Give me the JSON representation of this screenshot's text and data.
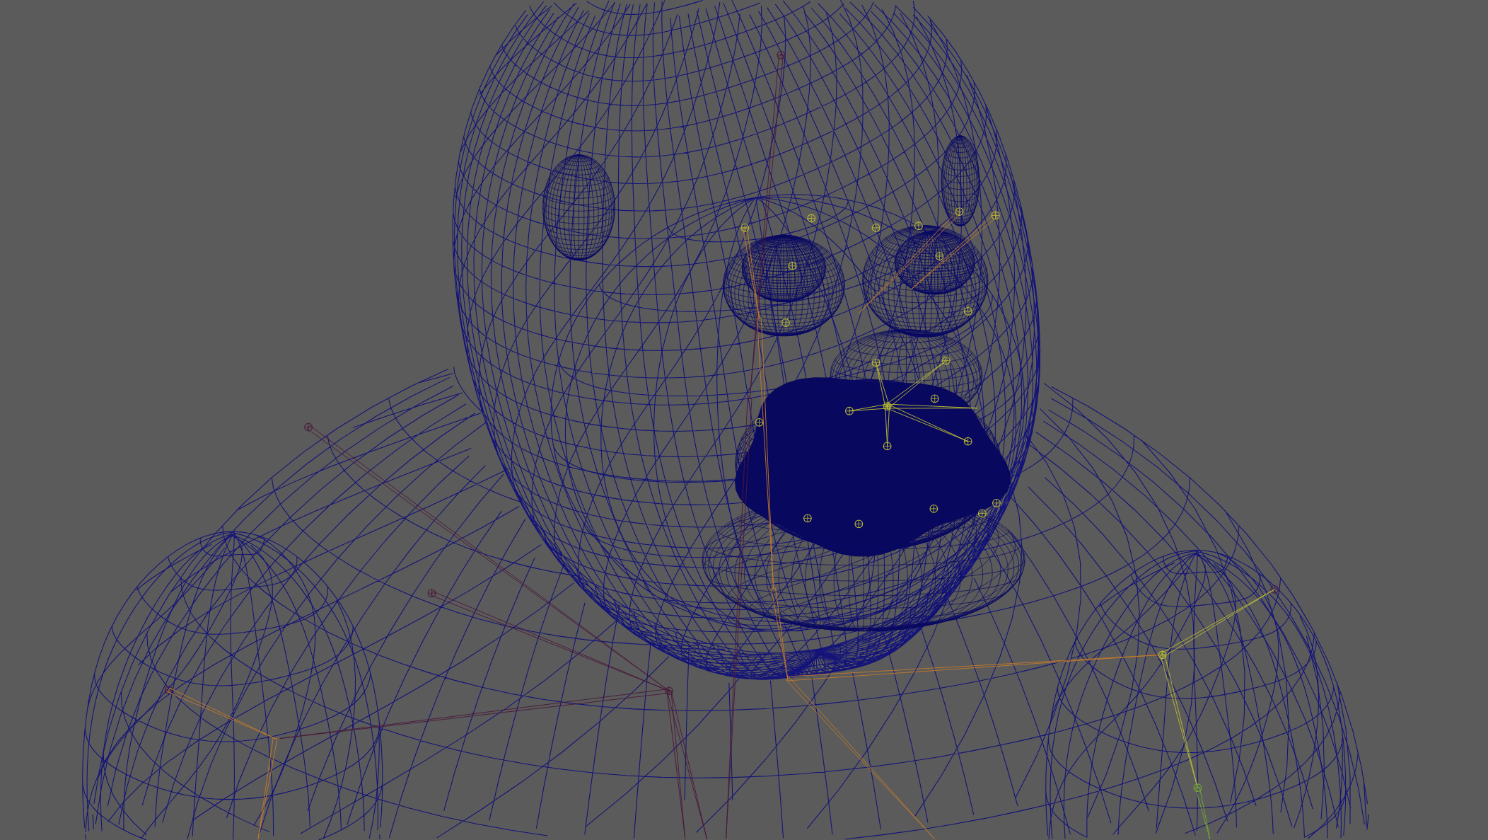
{
  "viewport": {
    "wireframe": true
  },
  "skeleton": {
    "chains": [
      {
        "color": "#4a1a3c"
      },
      {
        "color": "#c27a2c"
      },
      {
        "color": "#bcbc34"
      },
      {
        "color": "#74a834"
      }
    ]
  }
}
